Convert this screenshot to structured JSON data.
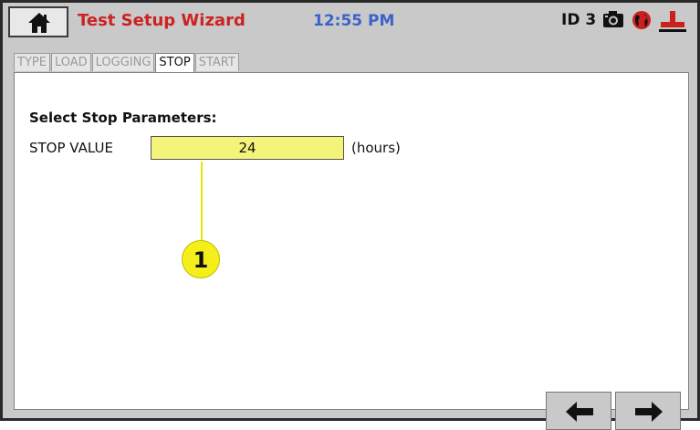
{
  "header": {
    "title": "Test Setup Wizard",
    "time": "12:55 PM",
    "device_id": "ID 3",
    "icons": [
      "home-icon",
      "camera-icon",
      "globe-icon",
      "plug-icon"
    ]
  },
  "tabs": [
    {
      "label": "TYPE",
      "active": false
    },
    {
      "label": "LOAD",
      "active": false
    },
    {
      "label": "LOGGING",
      "active": false
    },
    {
      "label": "STOP",
      "active": true
    },
    {
      "label": "START",
      "active": false
    }
  ],
  "stop": {
    "heading": "Select Stop Parameters:",
    "field_label": "STOP VALUE",
    "value": "24",
    "unit": "(hours)"
  },
  "callout": {
    "number": "1"
  },
  "nav": {
    "back_icon": "arrow-left-icon",
    "next_icon": "arrow-right-icon"
  },
  "colors": {
    "title": "#cc2222",
    "clock": "#3a63c8",
    "input_bg": "#f4f47a",
    "callout": "#f4ef1a"
  }
}
